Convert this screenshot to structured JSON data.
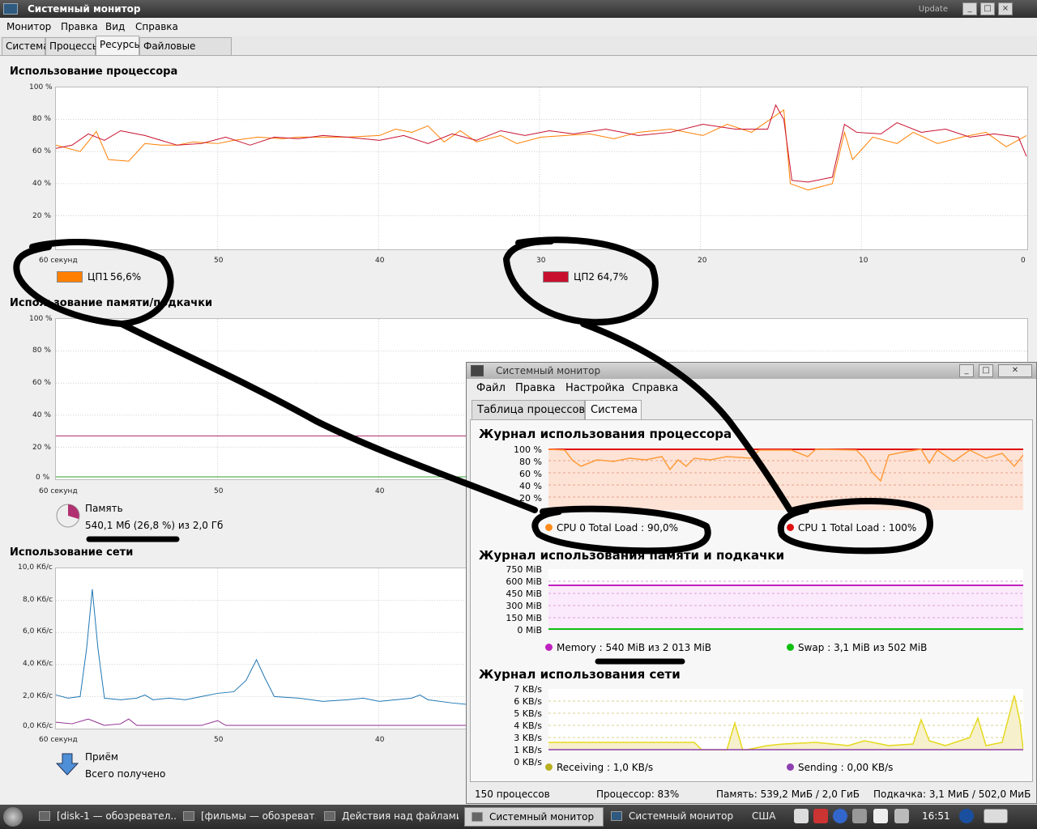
{
  "main_window": {
    "title": "Системный монитор",
    "title_right": "Update",
    "menu": [
      "Монитор",
      "Правка",
      "Вид",
      "Справка"
    ],
    "tabs": [
      "Система",
      "Процессы",
      "Ресурсы",
      "Файловые системы"
    ],
    "active_tab": "Ресурсы"
  },
  "cpu_section": {
    "title": "Использование процессора",
    "y_ticks": [
      "100 %",
      "80 %",
      "60 %",
      "40 %",
      "20 %",
      "0 %"
    ],
    "x_ticks": [
      "60 секунд",
      "50",
      "40",
      "30",
      "20",
      "10",
      "0"
    ],
    "cpu1": {
      "label": "ЦП1",
      "value": "56,6%",
      "color": "#ff7f00"
    },
    "cpu2": {
      "label": "ЦП2",
      "value": "64,7%",
      "color": "#c8102e"
    }
  },
  "mem_section": {
    "title": "Использование памяти/подкачки",
    "y_ticks": [
      "100 %",
      "80 %",
      "60 %",
      "40 %",
      "20 %",
      "0 %"
    ],
    "x_ticks": [
      "60 секунд",
      "50",
      "40"
    ],
    "memory_label": "Память",
    "memory_value": "540,1 Мб (26,8 %) из 2,0 Гб"
  },
  "net_section": {
    "title": "Использование сети",
    "y_ticks": [
      "10,0 Кб/с",
      "8,0 Кб/с",
      "6,0 Кб/с",
      "4,0 Кб/с",
      "2,0 Кб/с",
      "0,0 Кб/с"
    ],
    "x_ticks": [
      "60 секунд",
      "50",
      "40"
    ],
    "receive_label": "Приём",
    "total_received_label": "Всего получено",
    "receive_color": "#1f77b4",
    "send_color": "#8e2c8e"
  },
  "second_window": {
    "title": "Системный монитор",
    "menu": [
      "Файл",
      "Правка",
      "Настройка",
      "Справка"
    ],
    "tabs": [
      "Таблица процессов",
      "Система"
    ],
    "active_tab": "Система",
    "cpu_title": "Журнал использования процессора",
    "cpu_y_ticks": [
      "100 %",
      "80 %",
      "60 %",
      "40 %",
      "20 %"
    ],
    "cpu0_legend": "CPU 0 Total Load : 90,0%",
    "cpu1_legend": "CPU 1 Total Load : 100%",
    "cpu0_color": "#ff8c1a",
    "cpu1_color": "#e01010",
    "mem_title": "Журнал использования памяти и подкачки",
    "mem_y_ticks": [
      "750 MiB",
      "600 MiB",
      "450 MiB",
      "300 MiB",
      "150 MiB",
      "0 MiB"
    ],
    "mem_legend": "Memory : 540 MiB из 2 013 MiB",
    "swap_legend": "Swap : 3,1 MiB из 502 MiB",
    "mem_color": "#c020c0",
    "swap_color": "#10c010",
    "net_title": "Журнал использования сети",
    "net_y_ticks": [
      "7 KB/s",
      "6 KB/s",
      "5 KB/s",
      "4 KB/s",
      "3 KB/s",
      "1 KB/s",
      "0 KB/s"
    ],
    "recv_legend": "Receiving : 1,0 KB/s",
    "send_legend": "Sending : 0,00 KB/s",
    "recv_color": "#b8b020",
    "send_color": "#8e40b0",
    "status": {
      "processes": "150 процессов",
      "cpu": "Процессор: 83%",
      "memory": "Память: 539,2 МиБ / 2,0 ГиБ",
      "swap": "Подкачка: 3,1 МиБ / 502,0 МиБ"
    }
  },
  "taskbar": {
    "buttons": [
      {
        "label": "[disk-1 — обозревател...",
        "active": false
      },
      {
        "label": "[фильмы — обозреват...",
        "active": false
      },
      {
        "label": "Действия над файлами",
        "active": false
      },
      {
        "label": "Системный монитор",
        "active": true
      },
      {
        "label": "Системный монитор",
        "active": false
      }
    ],
    "keyboard_layout": "США",
    "clock": "16:51"
  }
}
